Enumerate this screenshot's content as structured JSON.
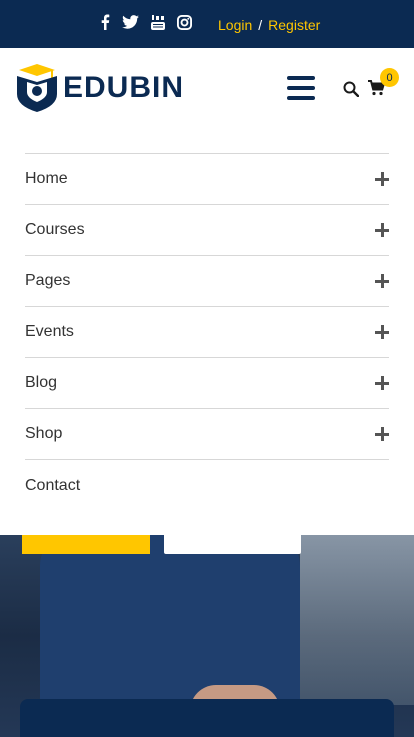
{
  "topbar": {
    "social_icons": [
      "facebook-icon",
      "twitter-icon",
      "youtube-icon",
      "instagram-icon"
    ],
    "login_label": "Login",
    "separator": "/",
    "register_label": "Register"
  },
  "header": {
    "logo_text": "EDUBIN",
    "cart_count": "0"
  },
  "menu": {
    "items": [
      {
        "label": "Home",
        "expandable": true
      },
      {
        "label": "Courses",
        "expandable": true
      },
      {
        "label": "Pages",
        "expandable": true
      },
      {
        "label": "Events",
        "expandable": true
      },
      {
        "label": "Blog",
        "expandable": true
      },
      {
        "label": "Shop",
        "expandable": true
      },
      {
        "label": "Contact",
        "expandable": false
      }
    ]
  },
  "colors": {
    "navy": "#0b2a52",
    "accent": "#ffc600"
  }
}
